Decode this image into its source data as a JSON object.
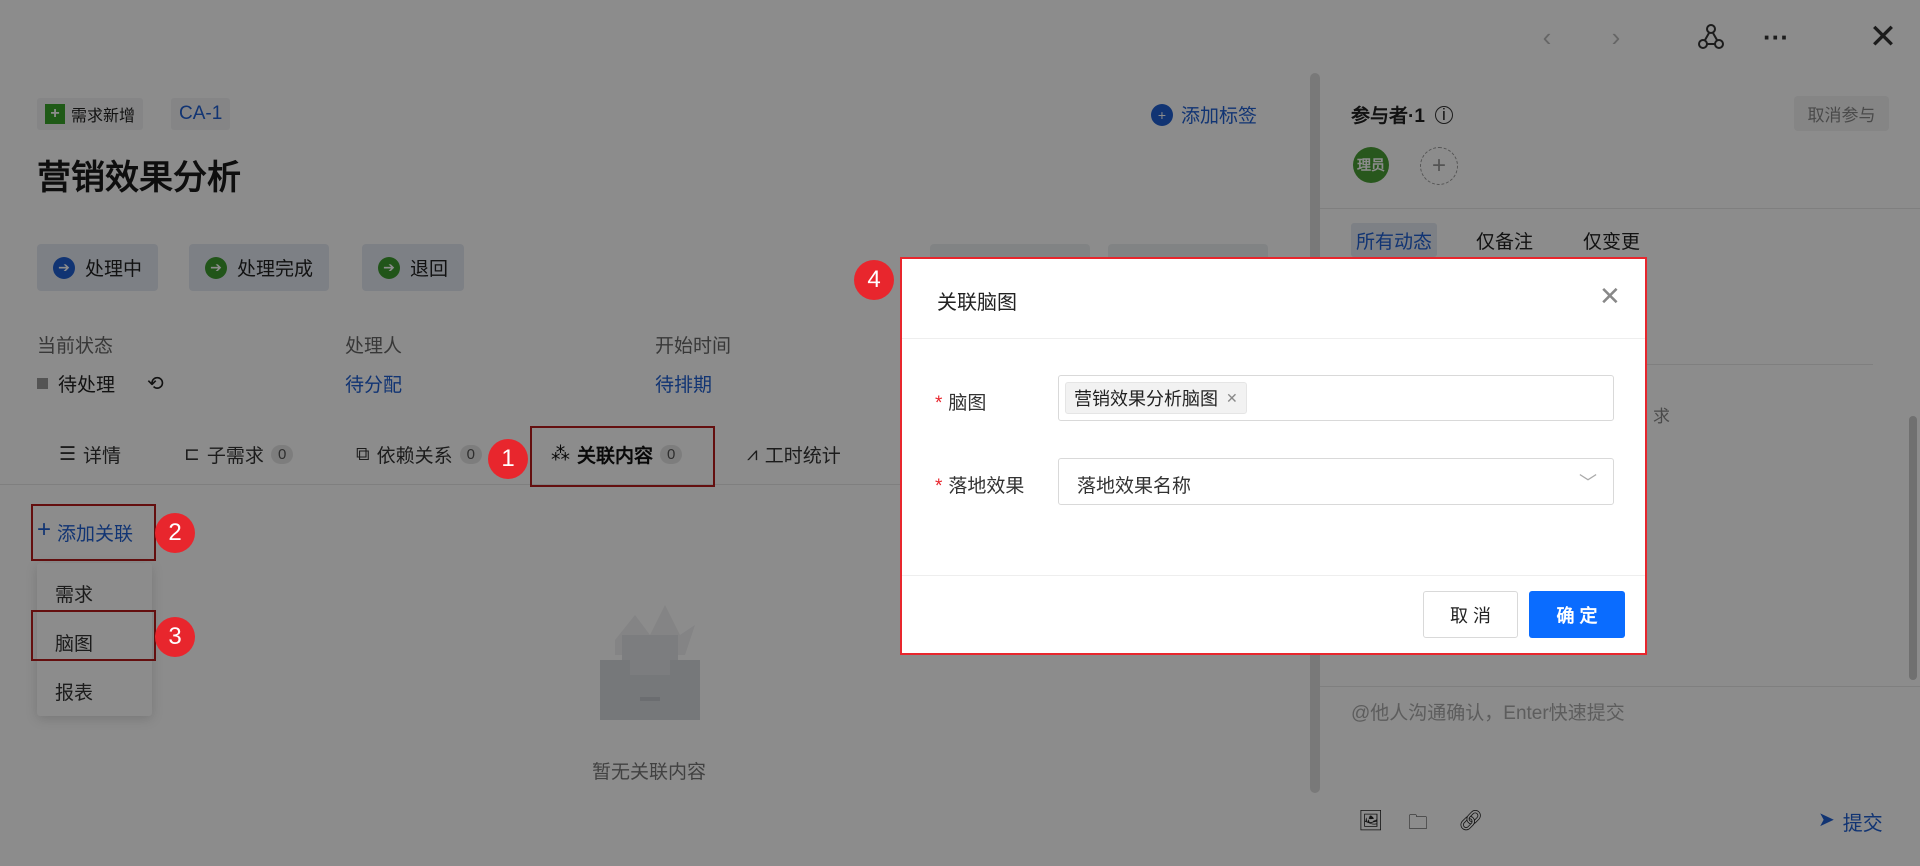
{
  "topbar": {
    "icons": [
      "chevron-left-icon",
      "chevron-right-icon",
      "mindmap-icon",
      "more-icon",
      "close-icon"
    ]
  },
  "header": {
    "type_tag": "需求新增",
    "id_tag": "CA-1",
    "add_tag": "添加标签",
    "title": "营销效果分析"
  },
  "actions": [
    {
      "label": "处理中",
      "color": "#1f5fd1"
    },
    {
      "label": "处理完成",
      "color": "#3d9b2f"
    },
    {
      "label": "退回",
      "color": "#3d9b2f"
    }
  ],
  "fields": [
    {
      "label": "当前状态",
      "value": "待处理"
    },
    {
      "label": "处理人",
      "value": "待分配"
    },
    {
      "label": "开始时间",
      "value": "待排期"
    }
  ],
  "tabs": [
    {
      "label": "详情"
    },
    {
      "label": "子需求",
      "count": "0"
    },
    {
      "label": "依赖关系",
      "count": "0"
    },
    {
      "label": "关联内容",
      "count": "0",
      "active": true
    },
    {
      "label": "工时统计"
    }
  ],
  "add_relation": {
    "label": "添加关联",
    "menu": [
      "需求",
      "脑图",
      "报表"
    ]
  },
  "empty": {
    "text": "暂无关联内容"
  },
  "steps": [
    "1",
    "2",
    "3",
    "4"
  ],
  "dialog": {
    "title": "关联脑图",
    "mindmap_label": "脑图",
    "mindmap_value": "营销效果分析脑图",
    "effect_label": "落地效果",
    "effect_placeholder": "落地效果名称",
    "cancel": "取 消",
    "ok": "确 定"
  },
  "right": {
    "participants": "参与者·1",
    "cancel_participate": "取消参与",
    "avatar": "理员",
    "tabs": [
      "所有动态",
      "仅备注",
      "仅变更"
    ],
    "fragment": "求",
    "comment_placeholder": "@他人沟通确认，Enter快速提交",
    "submit": "提交"
  },
  "colors": {
    "primary": "#0a6cff",
    "link": "#1f5fd1",
    "annotation": "#e8262d"
  }
}
